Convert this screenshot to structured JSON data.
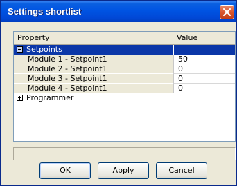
{
  "window": {
    "title": "Settings shortlist",
    "close_label": "×"
  },
  "grid": {
    "columns": [
      "Property",
      "Value"
    ],
    "rows": [
      {
        "kind": "category",
        "label": "Setpoints",
        "expanded": true,
        "value": ""
      },
      {
        "kind": "item",
        "label": "Module 1 - Setpoint1",
        "value": "50"
      },
      {
        "kind": "item",
        "label": "Module 2 - Setpoint1",
        "value": "0"
      },
      {
        "kind": "item",
        "label": "Module 3 - Setpoint1",
        "value": "0"
      },
      {
        "kind": "item",
        "label": "Module 4 - Setpoint1",
        "value": "0"
      },
      {
        "kind": "category",
        "label": "Programmer",
        "expanded": false,
        "value": ""
      }
    ]
  },
  "description": "",
  "buttons": {
    "ok": "OK",
    "apply": "Apply",
    "cancel": "Cancel"
  },
  "colors": {
    "selection": "#0b37a8",
    "titlebar": "#0054e3",
    "close_button": "#d8562f",
    "dialog_background": "#ece9d8"
  },
  "icons": {
    "collapse": "minus-box",
    "expand": "plus-box",
    "close": "x-mark"
  }
}
